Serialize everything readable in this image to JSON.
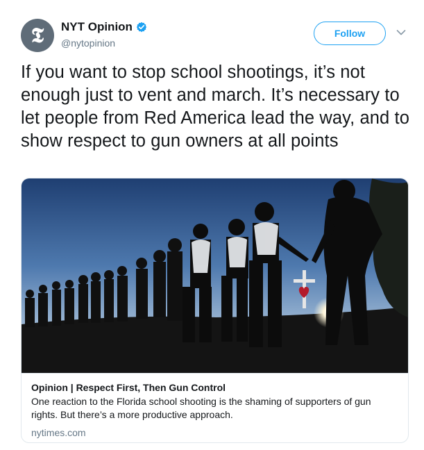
{
  "author": {
    "display_name": "NYT Opinion",
    "handle": "@nytopinion",
    "avatar_icon": "nyt-t-logo-icon",
    "verified_icon": "verified-badge-icon"
  },
  "actions": {
    "follow_label": "Follow",
    "more_icon": "chevron-down-icon"
  },
  "tweet": {
    "text": "If you want to stop school shootings, it’s not enough just to vent and march. It’s necessary to let people from Red America lead the way, and to show respect to gun owners at all points"
  },
  "card": {
    "image_description_icon": "students-holding-hands-photo",
    "title": "Opinion | Respect First, Then Gun Control",
    "description": "One reaction to the Florida school shooting is the shaming of supporters of gun rights. But there’s a more productive approach.",
    "domain": "nytimes.com"
  },
  "colors": {
    "accent": "#1da1f2",
    "secondary_text": "#657786",
    "border": "#e1e8ed",
    "avatar_bg": "#5f6c78"
  }
}
